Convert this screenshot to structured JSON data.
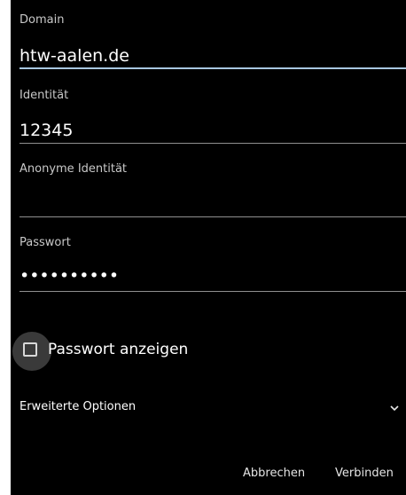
{
  "fields": {
    "domain": {
      "label": "Domain",
      "value": "htw-aalen.de"
    },
    "identity": {
      "label": "Identität",
      "value": "12345"
    },
    "anonymous_identity": {
      "label": "Anonyme Identität",
      "value": ""
    },
    "password": {
      "label": "Passwort",
      "value": "••••••••••"
    }
  },
  "show_password": {
    "label": "Passwort anzeigen",
    "checked": false
  },
  "advanced": {
    "label": "Erweiterte Optionen",
    "icon": "chevron-down-icon"
  },
  "buttons": {
    "cancel": "Abbrechen",
    "connect": "Verbinden"
  },
  "colors": {
    "background": "#000000",
    "focus_underline": "#a8c7e0"
  }
}
